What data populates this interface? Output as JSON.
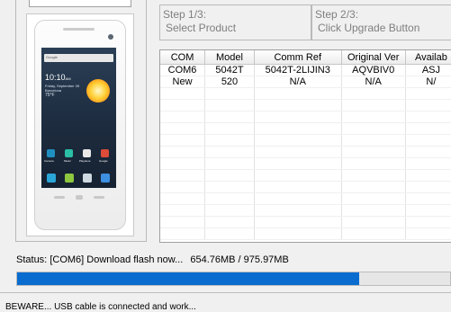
{
  "steps": {
    "step1": {
      "title": "Step 1/3:",
      "text": "Select Product"
    },
    "step2": {
      "title": "Step 2/3:",
      "text": "Click Upgrade Button"
    }
  },
  "device_preview": {
    "search_label": "Google",
    "clock": "10:10",
    "clock_suffix": "AM",
    "date": "Friday, September 26",
    "location": "Barcelona",
    "temperature": "75°F",
    "dock_labels": [
      "Camera",
      "Music",
      "Playstore",
      "Google"
    ]
  },
  "table": {
    "columns": [
      "COM",
      "Model",
      "Comm Ref",
      "Original Ver",
      "Availab"
    ],
    "rows": [
      [
        "COM6",
        "5042T",
        "5042T-2LIJIN3",
        "AQVBIV0",
        "ASJ"
      ],
      [
        "New",
        "520",
        "N/A",
        "N/A",
        "N/"
      ]
    ]
  },
  "status": {
    "label": "Status:",
    "message": "[COM6] Download flash now...",
    "transferred": "654.76MB / 975.97MB"
  },
  "progress": {
    "fraction": 0.79,
    "color": "#0a6ccf"
  },
  "footer": {
    "notice": "BEWARE... USB cable is connected and work..."
  }
}
